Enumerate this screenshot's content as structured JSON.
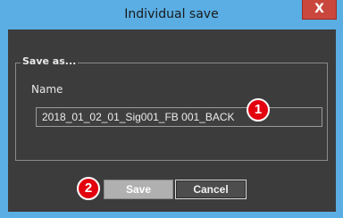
{
  "window": {
    "title": "Individual save",
    "close_glyph": "X"
  },
  "dialog": {
    "group_title": "Save as...",
    "name_label": "Name",
    "name_value": "2018_01_02_01_Sig001_FB 001_BACK"
  },
  "buttons": {
    "save_label": "Save",
    "cancel_label": "Cancel"
  },
  "markers": {
    "one": "1",
    "two": "2"
  },
  "colors": {
    "titlebar": "#5aaee4",
    "close": "#c9473d",
    "client": "#3c3c3c",
    "marker": "#e3000f"
  }
}
